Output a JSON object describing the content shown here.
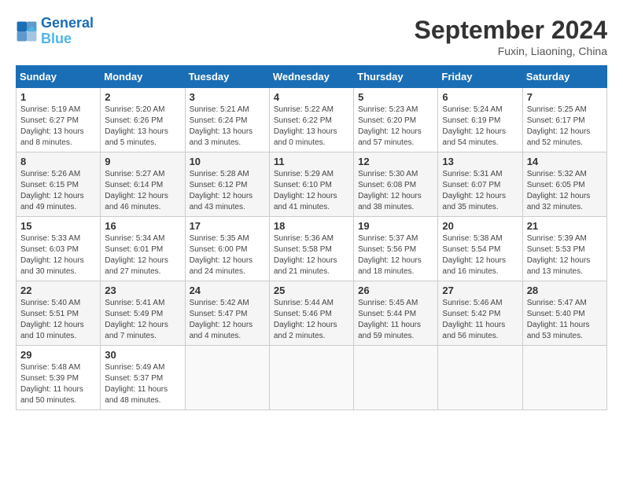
{
  "header": {
    "logo_general": "General",
    "logo_blue": "Blue",
    "month_title": "September 2024",
    "subtitle": "Fuxin, Liaoning, China"
  },
  "weekdays": [
    "Sunday",
    "Monday",
    "Tuesday",
    "Wednesday",
    "Thursday",
    "Friday",
    "Saturday"
  ],
  "weeks": [
    [
      {
        "day": "1",
        "info": "Sunrise: 5:19 AM\nSunset: 6:27 PM\nDaylight: 13 hours\nand 8 minutes."
      },
      {
        "day": "2",
        "info": "Sunrise: 5:20 AM\nSunset: 6:26 PM\nDaylight: 13 hours\nand 5 minutes."
      },
      {
        "day": "3",
        "info": "Sunrise: 5:21 AM\nSunset: 6:24 PM\nDaylight: 13 hours\nand 3 minutes."
      },
      {
        "day": "4",
        "info": "Sunrise: 5:22 AM\nSunset: 6:22 PM\nDaylight: 13 hours\nand 0 minutes."
      },
      {
        "day": "5",
        "info": "Sunrise: 5:23 AM\nSunset: 6:20 PM\nDaylight: 12 hours\nand 57 minutes."
      },
      {
        "day": "6",
        "info": "Sunrise: 5:24 AM\nSunset: 6:19 PM\nDaylight: 12 hours\nand 54 minutes."
      },
      {
        "day": "7",
        "info": "Sunrise: 5:25 AM\nSunset: 6:17 PM\nDaylight: 12 hours\nand 52 minutes."
      }
    ],
    [
      {
        "day": "8",
        "info": "Sunrise: 5:26 AM\nSunset: 6:15 PM\nDaylight: 12 hours\nand 49 minutes."
      },
      {
        "day": "9",
        "info": "Sunrise: 5:27 AM\nSunset: 6:14 PM\nDaylight: 12 hours\nand 46 minutes."
      },
      {
        "day": "10",
        "info": "Sunrise: 5:28 AM\nSunset: 6:12 PM\nDaylight: 12 hours\nand 43 minutes."
      },
      {
        "day": "11",
        "info": "Sunrise: 5:29 AM\nSunset: 6:10 PM\nDaylight: 12 hours\nand 41 minutes."
      },
      {
        "day": "12",
        "info": "Sunrise: 5:30 AM\nSunset: 6:08 PM\nDaylight: 12 hours\nand 38 minutes."
      },
      {
        "day": "13",
        "info": "Sunrise: 5:31 AM\nSunset: 6:07 PM\nDaylight: 12 hours\nand 35 minutes."
      },
      {
        "day": "14",
        "info": "Sunrise: 5:32 AM\nSunset: 6:05 PM\nDaylight: 12 hours\nand 32 minutes."
      }
    ],
    [
      {
        "day": "15",
        "info": "Sunrise: 5:33 AM\nSunset: 6:03 PM\nDaylight: 12 hours\nand 30 minutes."
      },
      {
        "day": "16",
        "info": "Sunrise: 5:34 AM\nSunset: 6:01 PM\nDaylight: 12 hours\nand 27 minutes."
      },
      {
        "day": "17",
        "info": "Sunrise: 5:35 AM\nSunset: 6:00 PM\nDaylight: 12 hours\nand 24 minutes."
      },
      {
        "day": "18",
        "info": "Sunrise: 5:36 AM\nSunset: 5:58 PM\nDaylight: 12 hours\nand 21 minutes."
      },
      {
        "day": "19",
        "info": "Sunrise: 5:37 AM\nSunset: 5:56 PM\nDaylight: 12 hours\nand 18 minutes."
      },
      {
        "day": "20",
        "info": "Sunrise: 5:38 AM\nSunset: 5:54 PM\nDaylight: 12 hours\nand 16 minutes."
      },
      {
        "day": "21",
        "info": "Sunrise: 5:39 AM\nSunset: 5:53 PM\nDaylight: 12 hours\nand 13 minutes."
      }
    ],
    [
      {
        "day": "22",
        "info": "Sunrise: 5:40 AM\nSunset: 5:51 PM\nDaylight: 12 hours\nand 10 minutes."
      },
      {
        "day": "23",
        "info": "Sunrise: 5:41 AM\nSunset: 5:49 PM\nDaylight: 12 hours\nand 7 minutes."
      },
      {
        "day": "24",
        "info": "Sunrise: 5:42 AM\nSunset: 5:47 PM\nDaylight: 12 hours\nand 4 minutes."
      },
      {
        "day": "25",
        "info": "Sunrise: 5:44 AM\nSunset: 5:46 PM\nDaylight: 12 hours\nand 2 minutes."
      },
      {
        "day": "26",
        "info": "Sunrise: 5:45 AM\nSunset: 5:44 PM\nDaylight: 11 hours\nand 59 minutes."
      },
      {
        "day": "27",
        "info": "Sunrise: 5:46 AM\nSunset: 5:42 PM\nDaylight: 11 hours\nand 56 minutes."
      },
      {
        "day": "28",
        "info": "Sunrise: 5:47 AM\nSunset: 5:40 PM\nDaylight: 11 hours\nand 53 minutes."
      }
    ],
    [
      {
        "day": "29",
        "info": "Sunrise: 5:48 AM\nSunset: 5:39 PM\nDaylight: 11 hours\nand 50 minutes."
      },
      {
        "day": "30",
        "info": "Sunrise: 5:49 AM\nSunset: 5:37 PM\nDaylight: 11 hours\nand 48 minutes."
      },
      {
        "day": "",
        "info": ""
      },
      {
        "day": "",
        "info": ""
      },
      {
        "day": "",
        "info": ""
      },
      {
        "day": "",
        "info": ""
      },
      {
        "day": "",
        "info": ""
      }
    ]
  ]
}
